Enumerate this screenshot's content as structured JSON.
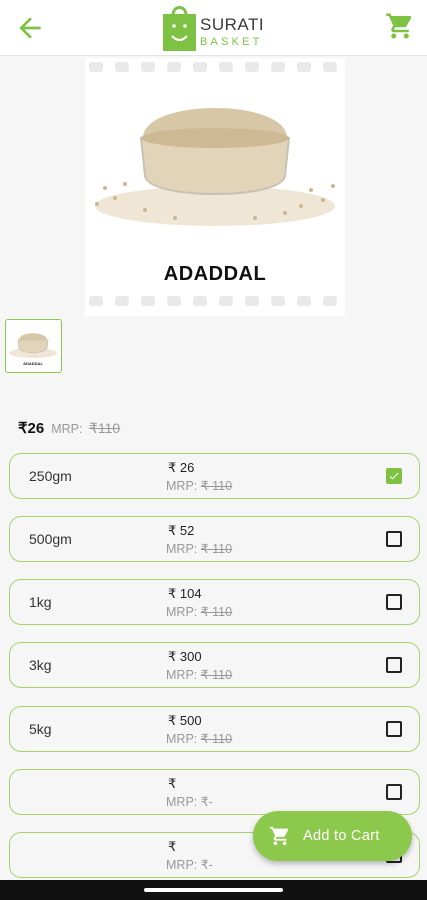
{
  "brand": {
    "name": "SURATI",
    "tagline": "BASKET",
    "accent": "#7dc243"
  },
  "header": {
    "back_icon": "arrow-left-icon",
    "cart_icon": "cart-icon"
  },
  "product": {
    "image_caption": "ADADDAL",
    "thumbnail_caption": "ADADDAL",
    "price": "₹26",
    "mrp_label": "MRP:",
    "mrp_value": "₹110"
  },
  "options": [
    {
      "size": "250gm",
      "price": "₹ 26",
      "mrp_label": "MRP:",
      "mrp_value": "₹ 110",
      "selected": true
    },
    {
      "size": "500gm",
      "price": "₹ 52",
      "mrp_label": "MRP:",
      "mrp_value": "₹ 110",
      "selected": false
    },
    {
      "size": "1kg",
      "price": "₹ 104",
      "mrp_label": "MRP:",
      "mrp_value": "₹ 110",
      "selected": false
    },
    {
      "size": "3kg",
      "price": "₹ 300",
      "mrp_label": "MRP:",
      "mrp_value": "₹ 110",
      "selected": false
    },
    {
      "size": "5kg",
      "price": "₹ 500",
      "mrp_label": "MRP:",
      "mrp_value": "₹ 110",
      "selected": false
    },
    {
      "size": "",
      "price": "₹",
      "mrp_label": "MRP:",
      "mrp_value": "₹-",
      "selected": false
    },
    {
      "size": "",
      "price": "₹",
      "mrp_label": "MRP:",
      "mrp_value": "₹-",
      "selected": false
    }
  ],
  "add_to_cart": {
    "label": "Add to Cart",
    "icon": "cart-icon"
  }
}
